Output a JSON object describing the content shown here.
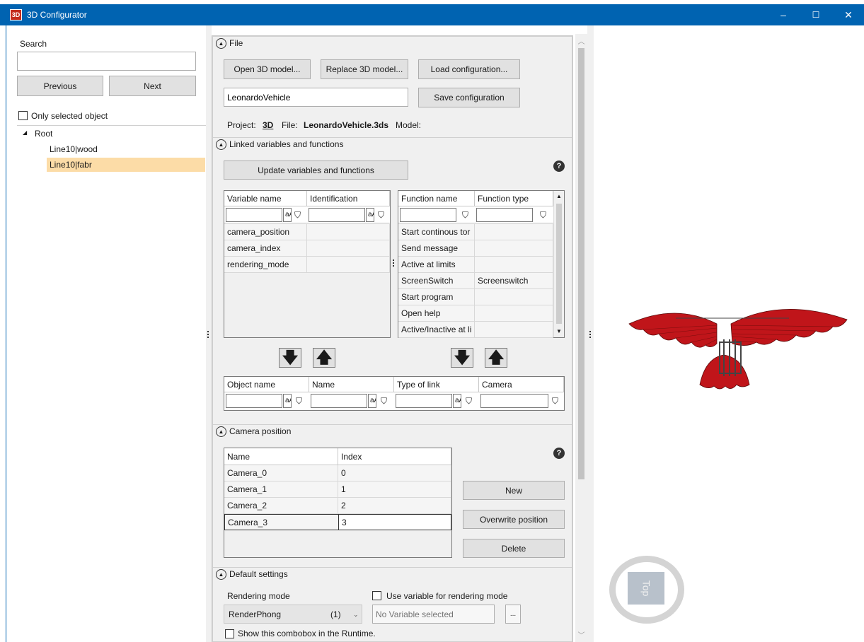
{
  "window": {
    "title": "3D Configurator",
    "icon_text": "3D",
    "minimize": "–",
    "maximize": "☐",
    "close": "✕"
  },
  "left_panel": {
    "search_label": "Search",
    "search_value": "",
    "previous_label": "Previous",
    "next_label": "Next",
    "only_selected_label": "Only selected object",
    "tree": {
      "root_label": "Root",
      "children": [
        "Line10|wood",
        "Line10|fabr"
      ],
      "selected": "Line10|fabr"
    }
  },
  "file_section": {
    "header": "File",
    "open_model_label": "Open 3D model...",
    "replace_model_label": "Replace 3D model...",
    "load_config_label": "Load configuration...",
    "config_name_value": "LeonardoVehicle",
    "save_config_label": "Save configuration",
    "project_label": "Project:",
    "project_value": "3D",
    "file_label": "File:",
    "file_value": "LeonardoVehicle.3ds",
    "model_label": "Model:"
  },
  "linked_section": {
    "header": "Linked variables and functions",
    "update_label": "Update variables and functions",
    "variables_table": {
      "columns": [
        "Variable name",
        "Identification"
      ],
      "filter_mode": "aA",
      "rows": [
        "camera_position",
        "camera_index",
        "rendering_mode"
      ]
    },
    "functions_table": {
      "columns": [
        "Function name",
        "Function type"
      ],
      "rows": [
        {
          "name": "Start continous tor",
          "type": ""
        },
        {
          "name": "Send message",
          "type": ""
        },
        {
          "name": "Active at limits",
          "type": ""
        },
        {
          "name": "ScreenSwitch",
          "type": "Screenswitch"
        },
        {
          "name": "Start program",
          "type": ""
        },
        {
          "name": "Open help",
          "type": ""
        },
        {
          "name": "Active/Inactive at li",
          "type": ""
        }
      ]
    },
    "links_table": {
      "columns": [
        "Object name",
        "Name",
        "Type of link",
        "Camera"
      ],
      "filter_mode": "aA"
    }
  },
  "camera_section": {
    "header": "Camera position",
    "columns": [
      "Name",
      "Index"
    ],
    "rows": [
      {
        "name": "Camera_0",
        "index": "0"
      },
      {
        "name": "Camera_1",
        "index": "1"
      },
      {
        "name": "Camera_2",
        "index": "2"
      },
      {
        "name": "Camera_3",
        "index": "3"
      }
    ],
    "new_label": "New",
    "overwrite_label": "Overwrite position",
    "delete_label": "Delete"
  },
  "defaults_section": {
    "header": "Default settings",
    "rendering_mode_label": "Rendering mode",
    "rendering_mode_value": "RenderPhong",
    "rendering_mode_index": "(1)",
    "use_variable_label": "Use variable for rendering mode",
    "variable_placeholder": "No Variable selected",
    "browse_label": "...",
    "show_combobox_label": "Show this combobox in the Runtime."
  },
  "viewport": {
    "nav_cube_label": "Top"
  },
  "colors": {
    "titlebar": "#0063b1",
    "selection": "#fcdca7",
    "model_red": "#c0151a"
  }
}
